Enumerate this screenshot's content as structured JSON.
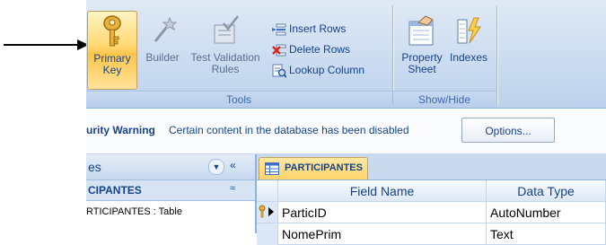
{
  "ribbon": {
    "groups": [
      {
        "label": "Tools",
        "buttons": [
          {
            "label_line1": "Primary",
            "label_line2": "Key",
            "icon": "key-icon",
            "state": "highlighted"
          },
          {
            "label_line1": "Builder",
            "label_line2": "",
            "icon": "builder-wand-icon",
            "state": "disabled"
          },
          {
            "label_line1": "Test Validation",
            "label_line2": "Rules",
            "icon": "test-validation-icon",
            "state": "disabled"
          }
        ],
        "small_buttons": [
          {
            "label": "Insert Rows",
            "icon": "insert-rows-icon"
          },
          {
            "label": "Delete Rows",
            "icon": "delete-rows-icon"
          },
          {
            "label": "Lookup Column",
            "icon": "lookup-column-icon"
          }
        ]
      },
      {
        "label": "Show/Hide",
        "buttons": [
          {
            "label_line1": "Property",
            "label_line2": "Sheet",
            "icon": "property-sheet-icon"
          },
          {
            "label_line1": "Indexes",
            "label_line2": "",
            "icon": "indexes-icon"
          }
        ]
      }
    ]
  },
  "security_bar": {
    "title": "urity Warning",
    "message": "Certain content in the database has been disabled",
    "options_label": "Options..."
  },
  "nav_pane": {
    "header": "es",
    "group": "CIPANTES",
    "item": "RTICIPANTES : Table"
  },
  "document": {
    "tab_label": "PARTICIPANTES",
    "columns": [
      "Field Name",
      "Data Type"
    ],
    "rows": [
      {
        "field": "ParticID",
        "type": "AutoNumber",
        "primary_key": true
      },
      {
        "field": "NomePrim",
        "type": "Text",
        "primary_key": false
      }
    ]
  },
  "colors": {
    "accent": "#15428b",
    "ribbon_bg": "#c7d9ef",
    "highlight": "#ffd872"
  }
}
